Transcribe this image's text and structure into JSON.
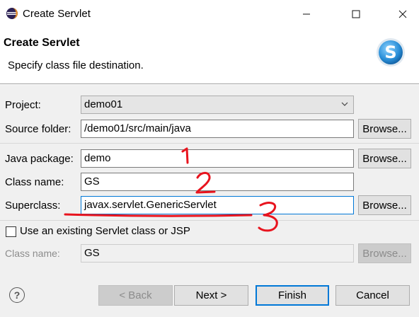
{
  "window": {
    "title": "Create Servlet",
    "minimize_glyph": "—",
    "maximize_glyph": "☐",
    "close_glyph": "✕"
  },
  "header": {
    "title": "Create Servlet",
    "description": "Specify class file destination."
  },
  "form": {
    "project_label": "Project:",
    "project_value": "demo01",
    "source_folder_label": "Source folder:",
    "source_folder_value": "/demo01/src/main/java",
    "java_package_label": "Java package:",
    "java_package_value": "demo",
    "class_name_label": "Class name:",
    "class_name_value": "GS",
    "superclass_label": "Superclass:",
    "superclass_value": "javax.servlet.GenericServlet",
    "browse_label": "Browse...",
    "existing_checkbox_label": "Use an existing Servlet class or JSP",
    "existing_checked": false,
    "existing_class_label": "Class name:",
    "existing_class_value": "GS"
  },
  "buttons": {
    "back": "< Back",
    "next": "Next >",
    "finish": "Finish",
    "cancel": "Cancel",
    "help_glyph": "?"
  },
  "annotations": {
    "mark1": "1",
    "mark2": "2",
    "mark3": "3",
    "color": "#e8141e"
  },
  "colors": {
    "accent": "#0078d7",
    "logo_blue": "#2a8fd8"
  }
}
